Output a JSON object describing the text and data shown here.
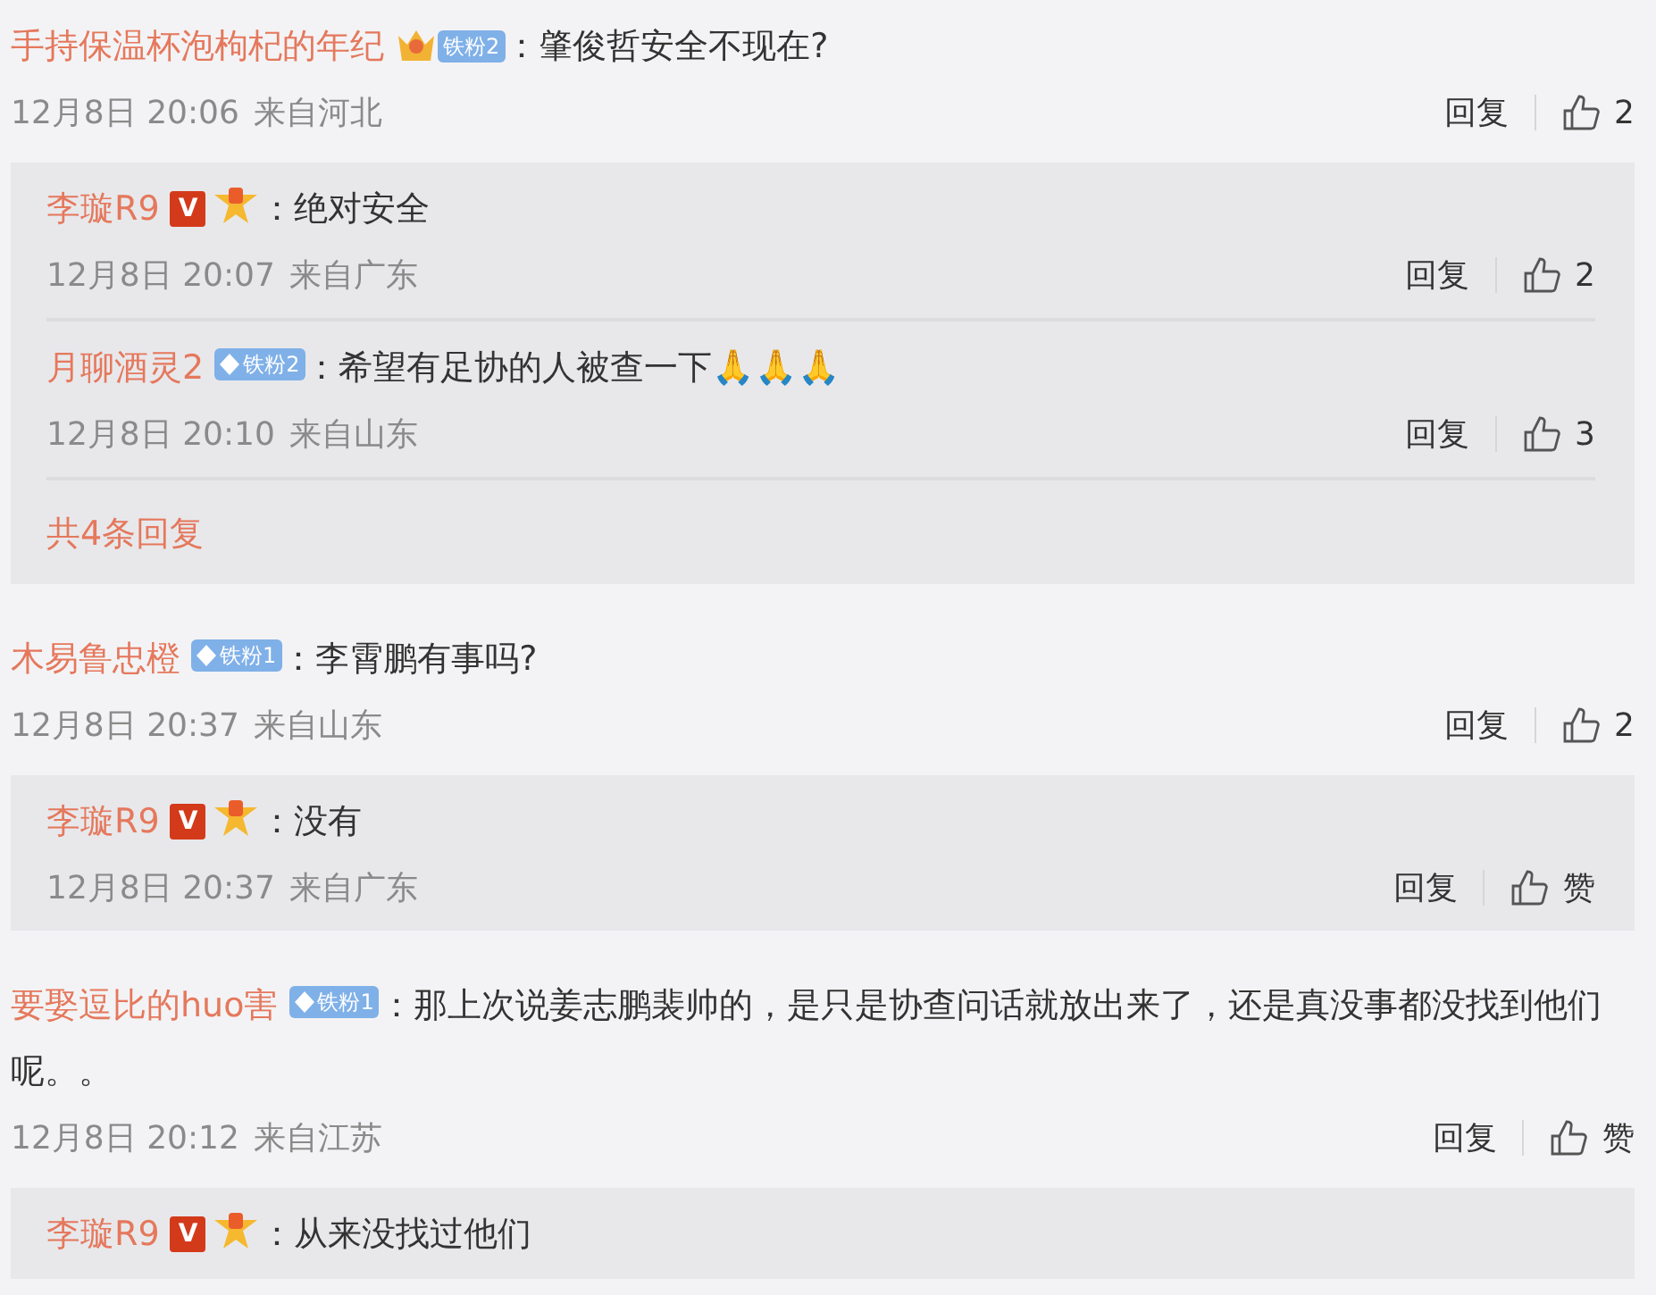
{
  "comments": [
    {
      "user": "手持保温杯泡枸杞的年纪",
      "badges": [
        {
          "kind": "crown-fan",
          "label": "铁粉2"
        }
      ],
      "text": "：肇俊哲安全不现在?",
      "date": "12月8日 20:06",
      "location": "来自河北",
      "reply_label": "回复",
      "likes": "2",
      "replies": [
        {
          "user": "李璇R9",
          "badges": [
            {
              "kind": "verified",
              "label": "V"
            },
            {
              "kind": "medal"
            }
          ],
          "text": "：绝对安全",
          "date": "12月8日 20:07",
          "location": "来自广东",
          "reply_label": "回复",
          "likes": "2"
        },
        {
          "user": "月聊酒灵2",
          "badges": [
            {
              "kind": "diamond-fan",
              "label": "铁粉2"
            }
          ],
          "text": "：希望有足协的人被查一下🙏🙏🙏",
          "date": "12月8日 20:10",
          "location": "来自山东",
          "reply_label": "回复",
          "likes": "3"
        }
      ],
      "more_replies": "共4条回复"
    },
    {
      "user": "木易鲁忠橙",
      "badges": [
        {
          "kind": "diamond-fan",
          "label": "铁粉1"
        }
      ],
      "text": "：李霄鹏有事吗?",
      "date": "12月8日 20:37",
      "location": "来自山东",
      "reply_label": "回复",
      "likes": "2",
      "replies": [
        {
          "user": "李璇R9",
          "badges": [
            {
              "kind": "verified",
              "label": "V"
            },
            {
              "kind": "medal"
            }
          ],
          "text": "：没有",
          "date": "12月8日 20:37",
          "location": "来自广东",
          "reply_label": "回复",
          "likes": "赞"
        }
      ]
    },
    {
      "user": "要娶逗比的huo害",
      "badges": [
        {
          "kind": "diamond-fan",
          "label": "铁粉1"
        }
      ],
      "text": "：那上次说姜志鹏裴帅的，是只是协查问话就放出来了，还是真没事都没找到他们呢。。",
      "date": "12月8日 20:12",
      "location": "来自江苏",
      "reply_label": "回复",
      "likes": "赞",
      "replies": [
        {
          "user": "李璇R9",
          "badges": [
            {
              "kind": "verified",
              "label": "V"
            },
            {
              "kind": "medal"
            }
          ],
          "text": "：从来没找过他们"
        }
      ]
    }
  ]
}
